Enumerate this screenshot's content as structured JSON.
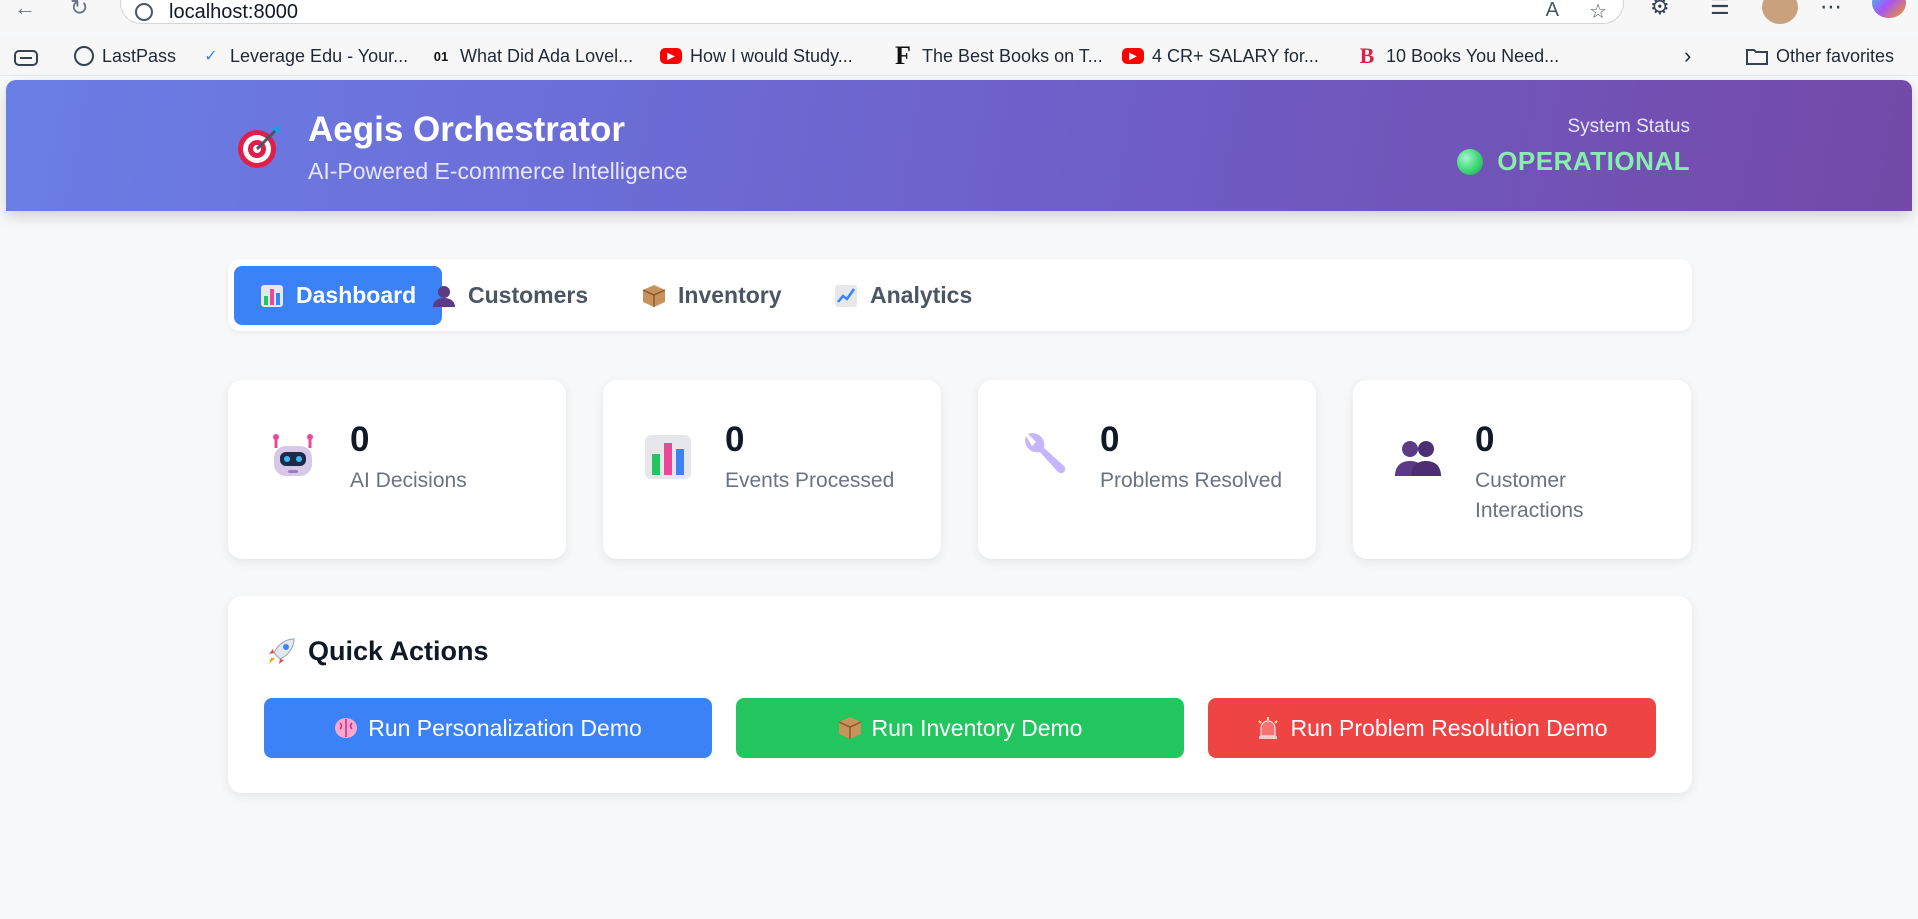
{
  "browser": {
    "url": "localhost:8000",
    "bookmarks": [
      {
        "label": "LastPass",
        "icon": "globe-icon"
      },
      {
        "label": "Leverage Edu - Your...",
        "icon": "leverage-icon"
      },
      {
        "label": "What Did Ada Lovel...",
        "icon": "ada-icon"
      },
      {
        "label": "How I would Study...",
        "icon": "youtube-icon"
      },
      {
        "label": "The Best Books on T...",
        "icon": "f-logo-icon"
      },
      {
        "label": "4 CR+ SALARY for...",
        "icon": "youtube-icon"
      },
      {
        "label": "10 Books You Need...",
        "icon": "b-logo-icon"
      }
    ],
    "other_favorites": "Other favorites"
  },
  "header": {
    "title": "Aegis Orchestrator",
    "subtitle": "AI-Powered E-commerce Intelligence",
    "status_label": "System Status",
    "status_value": "OPERATIONAL",
    "status_color": "#86efac"
  },
  "tabs": [
    {
      "label": "Dashboard",
      "icon": "bar-chart-icon",
      "active": true
    },
    {
      "label": "Customers",
      "icon": "user-icon",
      "active": false
    },
    {
      "label": "Inventory",
      "icon": "package-icon",
      "active": false
    },
    {
      "label": "Analytics",
      "icon": "trend-chart-icon",
      "active": false
    }
  ],
  "stats": [
    {
      "value": "0",
      "label": "AI Decisions",
      "icon": "robot-icon"
    },
    {
      "value": "0",
      "label": "Events Processed",
      "icon": "bar-chart-icon"
    },
    {
      "value": "0",
      "label": "Problems Resolved",
      "icon": "wrench-icon"
    },
    {
      "value": "0",
      "label": "Customer Interactions",
      "icon": "users-icon"
    }
  ],
  "quick_actions": {
    "title": "Quick Actions",
    "buttons": [
      {
        "label": "Run Personalization Demo",
        "icon": "brain-icon",
        "color": "#3b82f6"
      },
      {
        "label": "Run Inventory Demo",
        "icon": "package-icon",
        "color": "#22c55e"
      },
      {
        "label": "Run Problem Resolution Demo",
        "icon": "siren-icon",
        "color": "#ef4444"
      }
    ]
  },
  "colors": {
    "accent": "#3b82f6",
    "header_gradient_start": "#6a7fe6",
    "header_gradient_end": "#7449a8"
  }
}
